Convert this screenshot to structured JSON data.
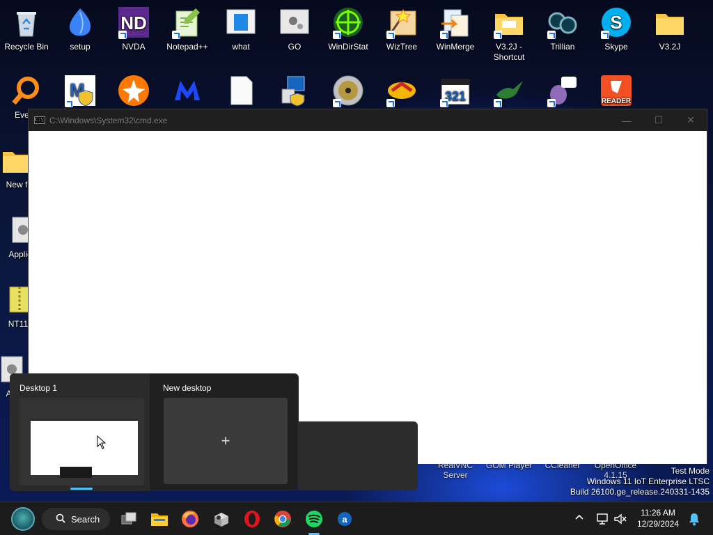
{
  "desktop": {
    "row1": [
      {
        "label": "Recycle Bin",
        "icon": "recycle-bin-icon"
      },
      {
        "label": "setup",
        "icon": "setup-icon"
      },
      {
        "label": "NVDA",
        "icon": "nvda-icon"
      },
      {
        "label": "Notepad++",
        "icon": "notepad-plus-plus-icon"
      },
      {
        "label": "what",
        "icon": "document-icon"
      },
      {
        "label": "GO",
        "icon": "gear-icon"
      },
      {
        "label": "WinDirStat",
        "icon": "windirstat-icon"
      },
      {
        "label": "WizTree",
        "icon": "wiztree-icon"
      },
      {
        "label": "WinMerge",
        "icon": "winmerge-icon"
      },
      {
        "label": "V3.2J - Shortcut",
        "icon": "folder-icon"
      },
      {
        "label": "Trillian",
        "icon": "trillian-icon"
      },
      {
        "label": "Skype",
        "icon": "skype-icon"
      },
      {
        "label": "V3.2J",
        "icon": "folder-icon"
      }
    ],
    "col_left": [
      {
        "label": "Everyt",
        "icon": "everything-search-icon"
      },
      {
        "label": "New f",
        "icon": "folder-icon"
      },
      {
        "label": "Applica",
        "icon": "gear-icon"
      },
      {
        "label": "NT11",
        "icon": "archive-icon"
      },
      {
        "label": "Ap",
        "icon": "gear-icon"
      }
    ],
    "row2_icons": [
      "malwarebytes-shield-icon",
      "avast-icon",
      "malwarebytes-icon",
      "document-icon",
      "installer-icon",
      "cd-burner-icon",
      "winamp-icon",
      "321-media-icon",
      "hummingbird-icon",
      "pidgin-icon",
      "foxit-reader-icon"
    ],
    "under_window_labels": [
      "RealVNC Server",
      "GOM Player",
      "CCleaner",
      "OpenOffice 4.1.15"
    ]
  },
  "cmd_window": {
    "title": "C:\\Windows\\System32\\cmd.exe",
    "icon_text": "C:\\",
    "minimize": "—",
    "maximize": "☐",
    "close": "✕"
  },
  "task_view": {
    "desktops": [
      {
        "label": "Desktop 1",
        "active": true
      },
      {
        "label": "New desktop",
        "add_symbol": "+"
      }
    ]
  },
  "watermark": {
    "line1": "Test Mode",
    "line2": "Windows 11 IoT Enterprise LTSC",
    "line3": "Build 26100.ge_release.240331-1435"
  },
  "taskbar": {
    "search_label": "Search",
    "apps": [
      "task-view-icon",
      "file-explorer-icon",
      "firefox-icon",
      "mystery-box-icon",
      "opera-icon",
      "chrome-icon",
      "spotify-icon",
      "blue-app-icon"
    ],
    "tray": {
      "chevron": "^"
    },
    "clock": {
      "time": "11:26 AM",
      "date": "12/29/2024"
    }
  },
  "colors": {
    "accent": "#4cc2ff",
    "taskbar": "#1c1c1c",
    "titlebar": "#1f1f1f"
  }
}
